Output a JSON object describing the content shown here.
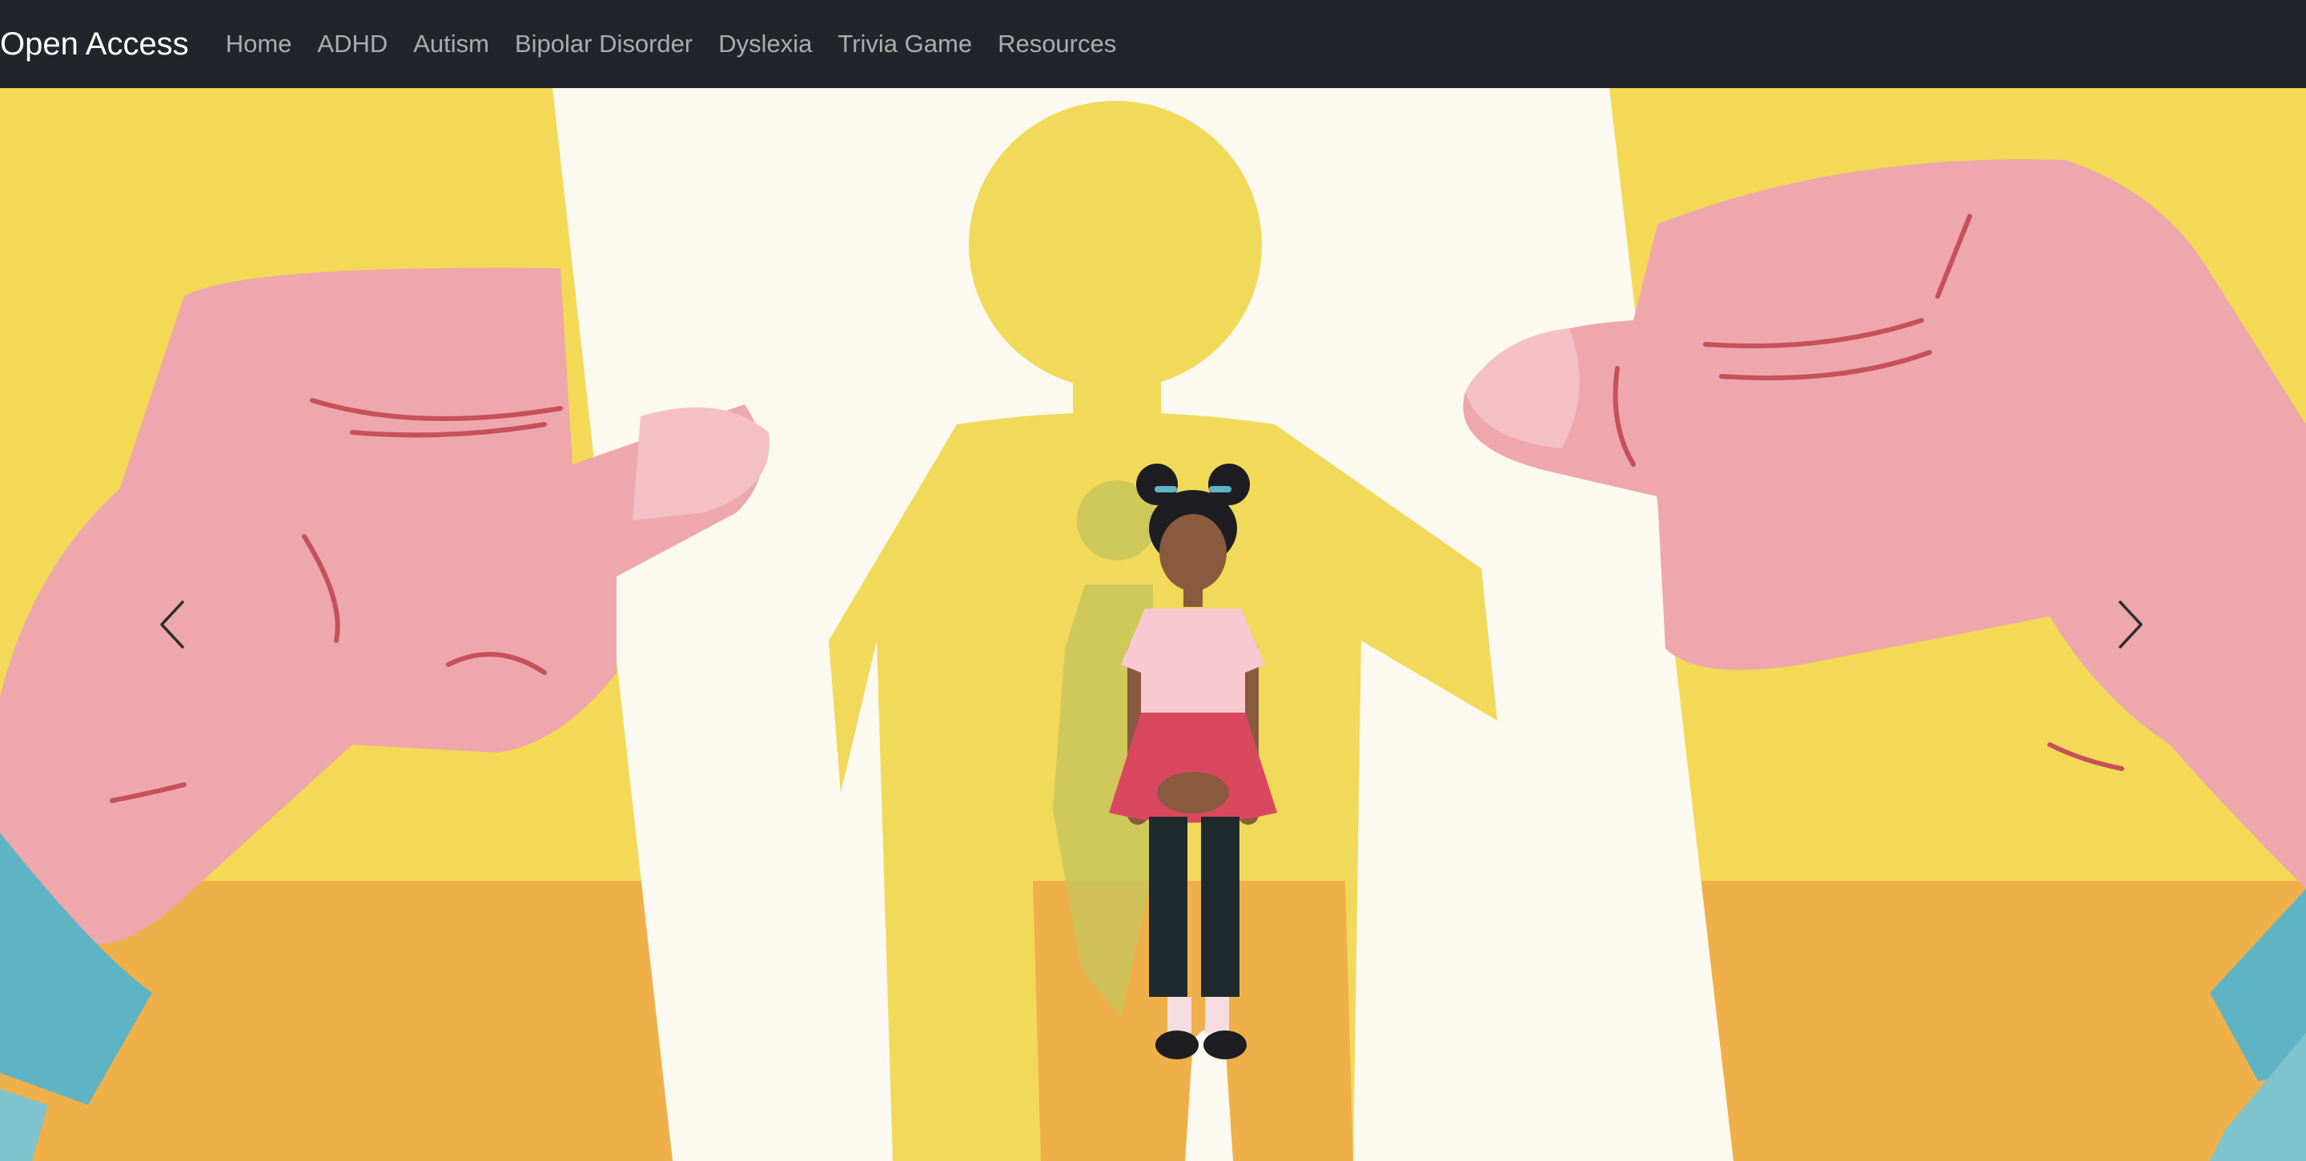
{
  "navbar": {
    "brand": "Open Access",
    "items": [
      {
        "label": "Home"
      },
      {
        "label": "ADHD"
      },
      {
        "label": "Autism"
      },
      {
        "label": "Bipolar Disorder"
      },
      {
        "label": "Dyslexia"
      },
      {
        "label": "Trivia Game"
      },
      {
        "label": "Resources"
      }
    ]
  },
  "carousel": {
    "slide_image": "illustration-hands-holding-paper-cutout-girl",
    "prev_icon": "chevron-left-icon",
    "next_icon": "chevron-right-icon"
  },
  "colors": {
    "navbar_bg": "#212529",
    "brand_text": "#ffffff",
    "nav_text": "#a6a8aa",
    "yellow": "#f3d955",
    "orange": "#efb04a",
    "pink": "#eda7ad",
    "paper": "#fbf9f0",
    "cuff": "#5fb4c3"
  }
}
